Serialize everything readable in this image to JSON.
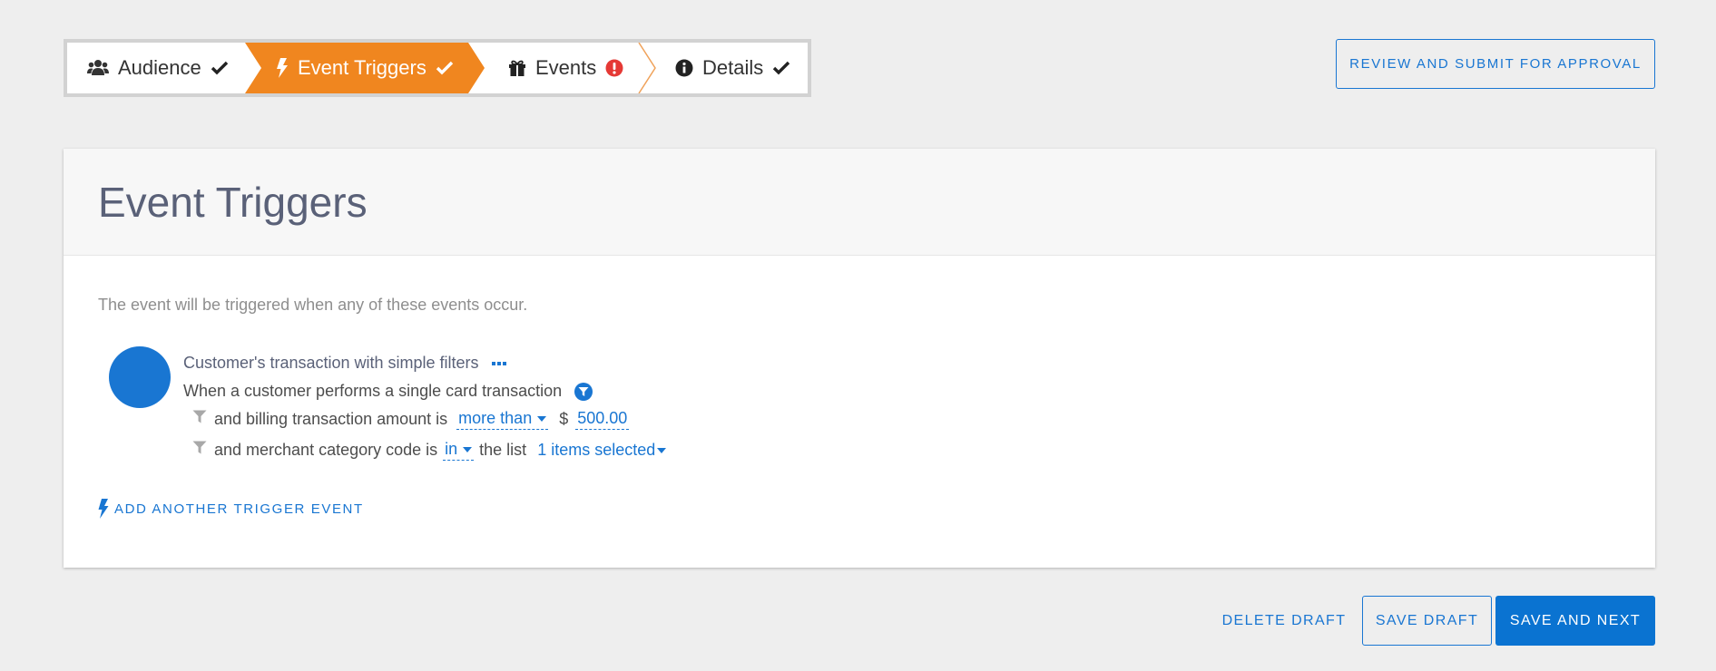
{
  "colors": {
    "accent": "#1976d2",
    "active_step": "#f0861f",
    "error": "#e53935",
    "background": "#eeeeee"
  },
  "stepper": {
    "steps": [
      {
        "label": "Audience",
        "icon": "users-icon",
        "status": "complete"
      },
      {
        "label": "Event Triggers",
        "icon": "bolt-icon",
        "status": "complete",
        "active": true
      },
      {
        "label": "Events",
        "icon": "gift-icon",
        "status": "error"
      },
      {
        "label": "Details",
        "icon": "info-icon",
        "status": "complete"
      }
    ]
  },
  "header": {
    "review_label": "REVIEW AND SUBMIT FOR APPROVAL"
  },
  "card": {
    "title": "Event Triggers",
    "intro": "The event will be triggered when any of these events occur.",
    "trigger": {
      "title": "Customer's transaction with simple filters",
      "description": "When a customer performs a single card transaction",
      "conditions": [
        {
          "prefix": "and billing transaction amount is",
          "operator": "more than",
          "currency": "$",
          "value": "500.00"
        },
        {
          "prefix": "and merchant category code is",
          "operator": "in",
          "middle": "the list",
          "selection": "1 items selected"
        }
      ]
    },
    "add_trigger_label": "ADD ANOTHER TRIGGER EVENT"
  },
  "footer": {
    "delete_label": "DELETE DRAFT",
    "save_draft_label": "SAVE DRAFT",
    "save_next_label": "SAVE AND NEXT"
  }
}
